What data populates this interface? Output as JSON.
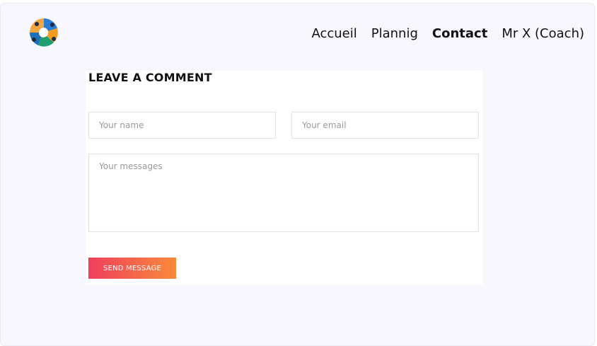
{
  "header": {
    "logo_icon": "colorful-circular-logo",
    "nav": [
      {
        "label": "Accueil",
        "active": false
      },
      {
        "label": "Plannig",
        "active": false
      },
      {
        "label": "Contact",
        "active": true
      },
      {
        "label": "Mr X (Coach)",
        "active": false
      }
    ]
  },
  "comment_form": {
    "title": "LEAVE A COMMENT",
    "name_placeholder": "Your name",
    "email_placeholder": "Your email",
    "message_placeholder": "Your messages",
    "send_label": "SEND MESSAGE"
  },
  "colors": {
    "page_background": "#f8f7fe",
    "button_gradient_start": "#ef3f5d",
    "button_gradient_end": "#f98a3a"
  }
}
